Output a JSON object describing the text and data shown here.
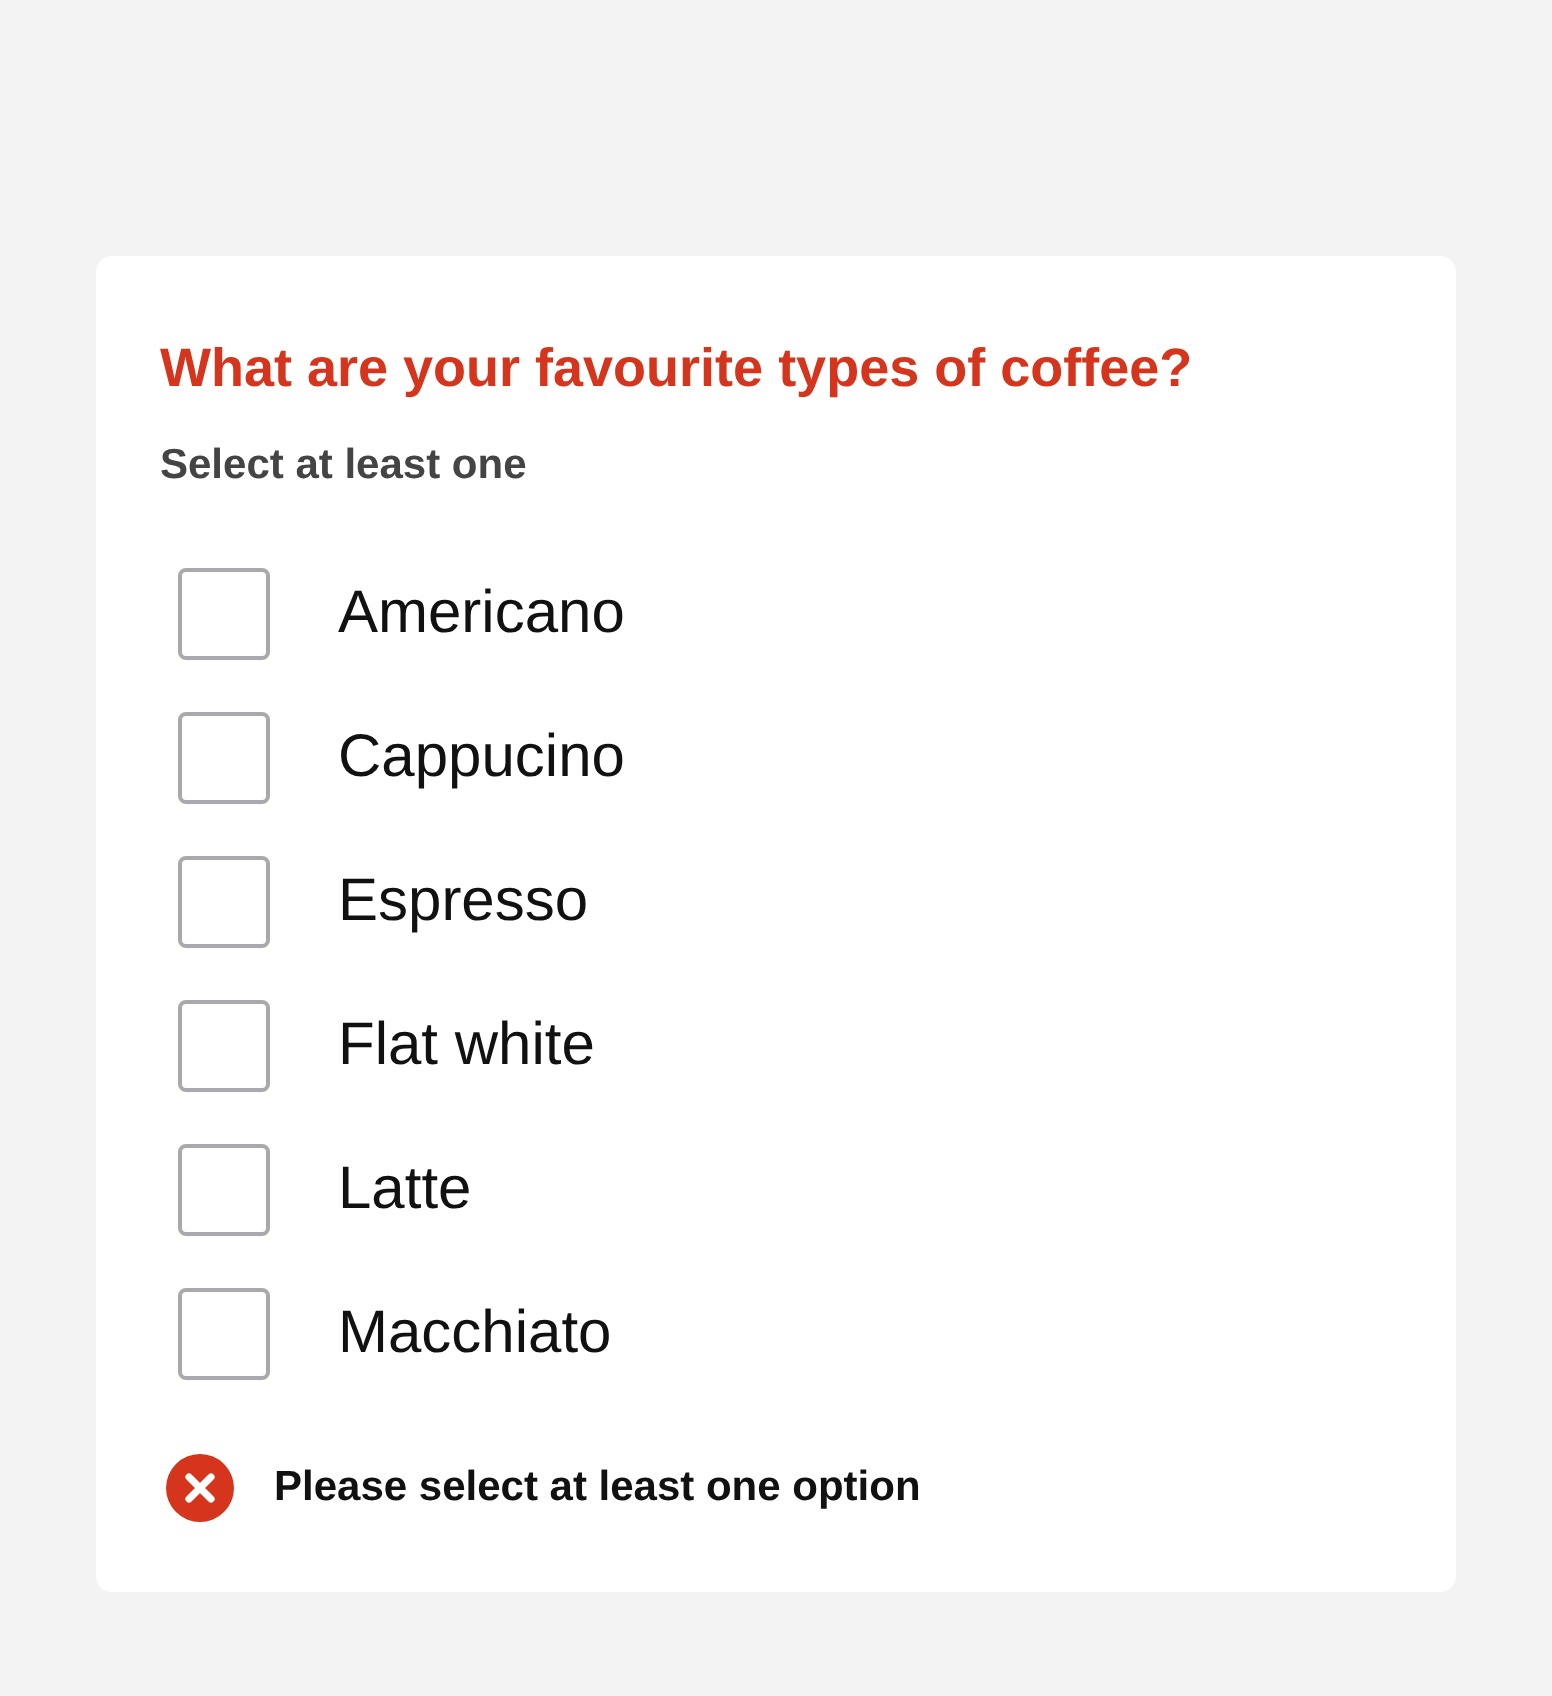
{
  "question": {
    "title": "What are your favourite types of coffee?",
    "hint": "Select at least one"
  },
  "options": [
    {
      "label": "Americano",
      "checked": false
    },
    {
      "label": "Cappucino",
      "checked": false
    },
    {
      "label": "Espresso",
      "checked": false
    },
    {
      "label": "Flat white",
      "checked": false
    },
    {
      "label": "Latte",
      "checked": false
    },
    {
      "label": "Macchiato",
      "checked": false
    }
  ],
  "error": {
    "message": "Please select at least one option"
  }
}
